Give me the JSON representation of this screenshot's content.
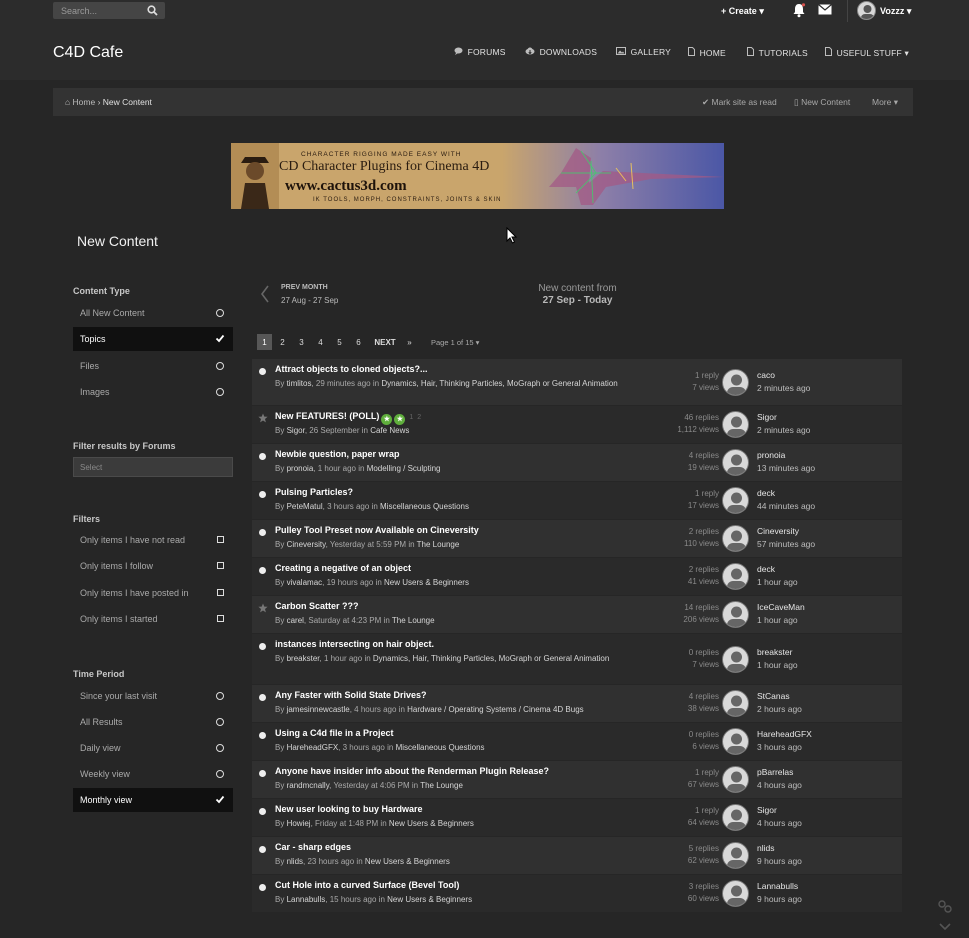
{
  "header": {
    "search_placeholder": "Search...",
    "create_label": "Create",
    "username": "Vozzz",
    "site_title": "C4D Cafe"
  },
  "nav": [
    {
      "label": "FORUMS",
      "icon": "chat-icon"
    },
    {
      "label": "DOWNLOADS",
      "icon": "cloud-download-icon"
    },
    {
      "label": "GALLERY",
      "icon": "image-icon"
    },
    {
      "label": "HOME",
      "icon": "page-icon"
    },
    {
      "label": "TUTORIALS",
      "icon": "page-icon"
    },
    {
      "label": "USEFUL STUFF",
      "icon": "page-icon"
    }
  ],
  "breadcrumb": {
    "home": "Home",
    "current": "New Content",
    "mark_read": "Mark site as read",
    "new_content": "New Content",
    "more": "More"
  },
  "banner": {
    "tagline": "CHARACTER RIGGING MADE EASY WITH",
    "title": "CD Character Plugins for Cinema 4D",
    "url": "www.cactus3d.com",
    "subline": "IK TOOLS, MORPH, CONSTRAINTS, JOINTS & SKIN"
  },
  "page_title": "New Content",
  "sidebar": {
    "content_type_heading": "Content Type",
    "content_types": [
      {
        "label": "All New Content",
        "active": false
      },
      {
        "label": "Topics",
        "active": true
      },
      {
        "label": "Files",
        "active": false
      },
      {
        "label": "Images",
        "active": false
      }
    ],
    "forum_filter_heading": "Filter results by Forums",
    "forum_select_placeholder": "Select",
    "filters_heading": "Filters",
    "filters": [
      {
        "label": "Only items I have not read"
      },
      {
        "label": "Only items I follow"
      },
      {
        "label": "Only items I have posted in"
      },
      {
        "label": "Only items I started"
      }
    ],
    "time_heading": "Time Period",
    "time_periods": [
      {
        "label": "Since your last visit",
        "active": false
      },
      {
        "label": "All Results",
        "active": false
      },
      {
        "label": "Daily view",
        "active": false
      },
      {
        "label": "Weekly view",
        "active": false
      },
      {
        "label": "Monthly view",
        "active": true
      }
    ]
  },
  "period": {
    "prev_label": "PREV MONTH",
    "prev_range": "27 Aug - 27 Sep",
    "from_label": "New content from",
    "from_range": "27 Sep - Today"
  },
  "pagination": {
    "pages": [
      "1",
      "2",
      "3",
      "4",
      "5",
      "6"
    ],
    "next": "NEXT",
    "page_of": "Page 1 of 15"
  },
  "topics": [
    {
      "title": "Attract objects to cloned objects?...",
      "by": "timlitos",
      "when": "29 minutes ago",
      "forum": "Dynamics, Hair, Thinking Particles, MoGraph or General Animation",
      "replies": "1 reply",
      "views": "7 views",
      "last_user": "caco",
      "last_time": "2 minutes ago",
      "marker": "dot"
    },
    {
      "title": "New FEATURES! (POLL)",
      "by": "Sigor",
      "when": "26 September",
      "forum": "Cafe News",
      "replies": "46 replies",
      "views": "1,112 views",
      "last_user": "Sigor",
      "last_time": "2 minutes ago",
      "marker": "star",
      "pages": [
        "1",
        "2"
      ]
    },
    {
      "title": "Newbie question, paper wrap",
      "by": "pronoia",
      "when": "1 hour ago",
      "forum": "Modelling / Sculpting",
      "replies": "4 replies",
      "views": "19 views",
      "last_user": "pronoia",
      "last_time": "13 minutes ago",
      "marker": "dot"
    },
    {
      "title": "Pulsing Particles?",
      "by": "PeteMatul",
      "when": "3 hours ago",
      "forum": "Miscellaneous Questions",
      "replies": "1 reply",
      "views": "17 views",
      "last_user": "deck",
      "last_time": "44 minutes ago",
      "marker": "dot"
    },
    {
      "title": "Pulley Tool Preset now Available on Cineversity",
      "by": "Cineversity",
      "when": "Yesterday at 5:59 PM",
      "forum": "The Lounge",
      "replies": "2 replies",
      "views": "110 views",
      "last_user": "Cineversity",
      "last_time": "57 minutes ago",
      "marker": "dot"
    },
    {
      "title": "Creating a negative of an object",
      "by": "vivalamac",
      "when": "19 hours ago",
      "forum": "New Users & Beginners",
      "replies": "2 replies",
      "views": "41 views",
      "last_user": "deck",
      "last_time": "1 hour ago",
      "marker": "dot"
    },
    {
      "title": "Carbon Scatter ???",
      "by": "carel",
      "when": "Saturday at 4:23 PM",
      "forum": "The Lounge",
      "replies": "14 replies",
      "views": "206 views",
      "last_user": "IceCaveMan",
      "last_time": "1 hour ago",
      "marker": "star"
    },
    {
      "title": "instances intersecting on hair object.",
      "by": "breakster",
      "when": "1 hour ago",
      "forum": "Dynamics, Hair, Thinking Particles, MoGraph or General Animation",
      "replies": "0 replies",
      "views": "7 views",
      "last_user": "breakster",
      "last_time": "1 hour ago",
      "marker": "dot"
    },
    {
      "title": "Any Faster with Solid State Drives?",
      "by": "jamesinnewcastle",
      "when": "4 hours ago",
      "forum": "Hardware / Operating Systems / Cinema 4D Bugs",
      "replies": "4 replies",
      "views": "38 views",
      "last_user": "StCanas",
      "last_time": "2 hours ago",
      "marker": "dot"
    },
    {
      "title": "Using a C4d file in a Project",
      "by": "HareheadGFX",
      "when": "3 hours ago",
      "forum": "Miscellaneous Questions",
      "replies": "0 replies",
      "views": "6 views",
      "last_user": "HareheadGFX",
      "last_time": "3 hours ago",
      "marker": "dot"
    },
    {
      "title": "Anyone have insider info about the Renderman Plugin Release?",
      "by": "randmcnally",
      "when": "Yesterday at 4:06 PM",
      "forum": "The Lounge",
      "replies": "1 reply",
      "views": "67 views",
      "last_user": "pBarrelas",
      "last_time": "4 hours ago",
      "marker": "dot"
    },
    {
      "title": "New user looking to buy Hardware",
      "by": "Howiej",
      "when": "Friday at 1:48 PM",
      "forum": "New Users & Beginners",
      "replies": "1 reply",
      "views": "64 views",
      "last_user": "Sigor",
      "last_time": "4 hours ago",
      "marker": "dot"
    },
    {
      "title": "Car - sharp edges",
      "by": "nlids",
      "when": "23 hours ago",
      "forum": "New Users & Beginners",
      "replies": "5 replies",
      "views": "62 views",
      "last_user": "nlids",
      "last_time": "9 hours ago",
      "marker": "dot"
    },
    {
      "title": "Cut Hole into a curved Surface (Bevel Tool)",
      "by": "Lannabulls",
      "when": "15 hours ago",
      "forum": "New Users & Beginners",
      "replies": "3 replies",
      "views": "60 views",
      "last_user": "Lannabulls",
      "last_time": "9 hours ago",
      "marker": "dot"
    }
  ],
  "topic_labels": {
    "by": "By",
    "in": "in"
  },
  "colors": {
    "background": "#262626",
    "topbar": "#2c2c2c",
    "active_item": "#101010",
    "badge": "#5fae3c"
  }
}
